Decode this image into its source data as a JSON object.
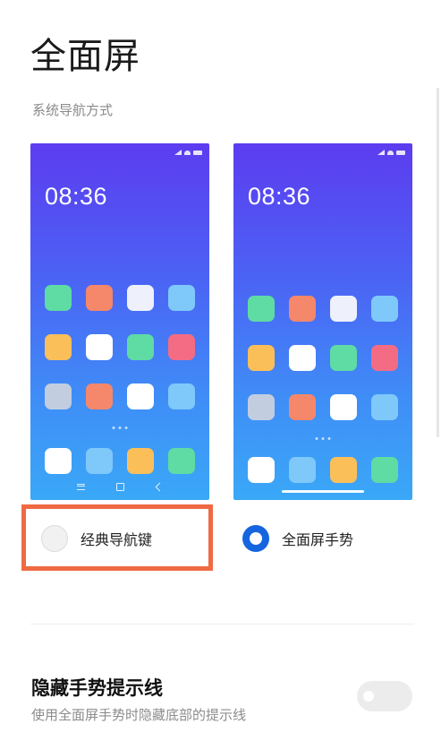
{
  "header": {
    "title": "全面屏"
  },
  "section": {
    "label": "系统导航方式"
  },
  "preview": {
    "time": "08:36",
    "icon_colors": [
      [
        "#5fdba4",
        "#f5876a",
        "#eef1fb",
        "#7fc8fa"
      ],
      [
        "#fbbf5a",
        "#ffffff",
        "#5fdba4",
        "#f46c84"
      ],
      [
        "#c2cde0",
        "#f5876a",
        "#ffffff",
        "#7fc8fa"
      ],
      [
        "#ffffff",
        "#7fc8fa",
        "#fbbf5a",
        "#5fdba4"
      ]
    ]
  },
  "options": {
    "classic": {
      "label": "经典导航键",
      "selected": false
    },
    "gesture": {
      "label": "全面屏手势",
      "selected": true
    }
  },
  "highlight_color": "#ef6a43",
  "accent_color": "#1565e0",
  "hide_gesture_line": {
    "title": "隐藏手势提示线",
    "subtitle": "使用全面屏手势时隐藏底部的提示线",
    "enabled": false
  }
}
